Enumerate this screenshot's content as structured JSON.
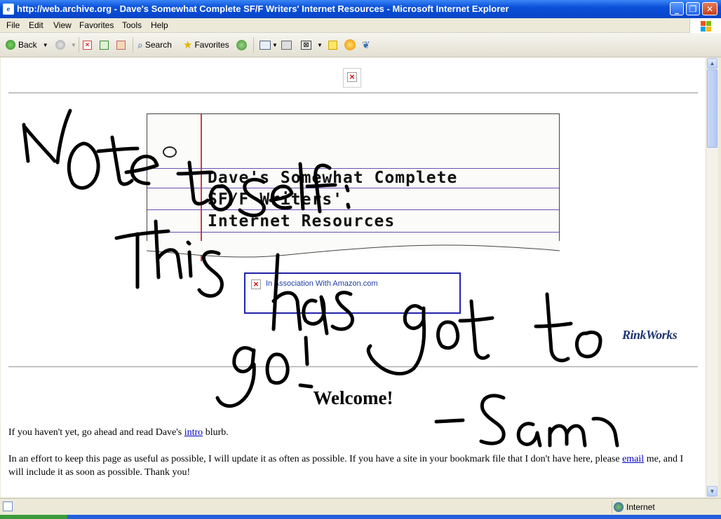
{
  "window": {
    "title": "http://web.archive.org - Dave's Somewhat Complete SF/F Writers' Internet Resources - Microsoft Internet Explorer",
    "minimize": "_",
    "maximize": "❐",
    "close": "✕"
  },
  "menu": [
    "File",
    "Edit",
    "View",
    "Favorites",
    "Tools",
    "Help"
  ],
  "toolbar": {
    "back": "Back",
    "search": "Search",
    "favorites": "Favorites"
  },
  "page": {
    "notebook_title": [
      "Dave's Somewhat Complete",
      "SF/F Writers'",
      "Internet Resources"
    ],
    "ad_label": "In Association With Amazon.com",
    "rinkworks": "RinkWorks",
    "welcome": "Welcome!",
    "p1": {
      "before": "If you haven't yet, go ahead and read Dave's ",
      "link": "intro",
      "after": " blurb."
    },
    "p2": {
      "before": "In an effort to keep this page as useful as possible, I will update it as often as possible. If you have a site in your bookmark file that I don't have here, please ",
      "link": "email",
      "after": " me, and I will include it as soon as possible. Thank you!"
    }
  },
  "handwritten_note": "Note to self: This has got to go! -Sam",
  "status": {
    "zone": "Internet"
  },
  "colors": {
    "titlebar": "#0a50d8",
    "link": "#0000cc",
    "margin_line": "#d23b3b",
    "ruled_line": "#6b4fb1",
    "ad_border": "#2222aa"
  }
}
